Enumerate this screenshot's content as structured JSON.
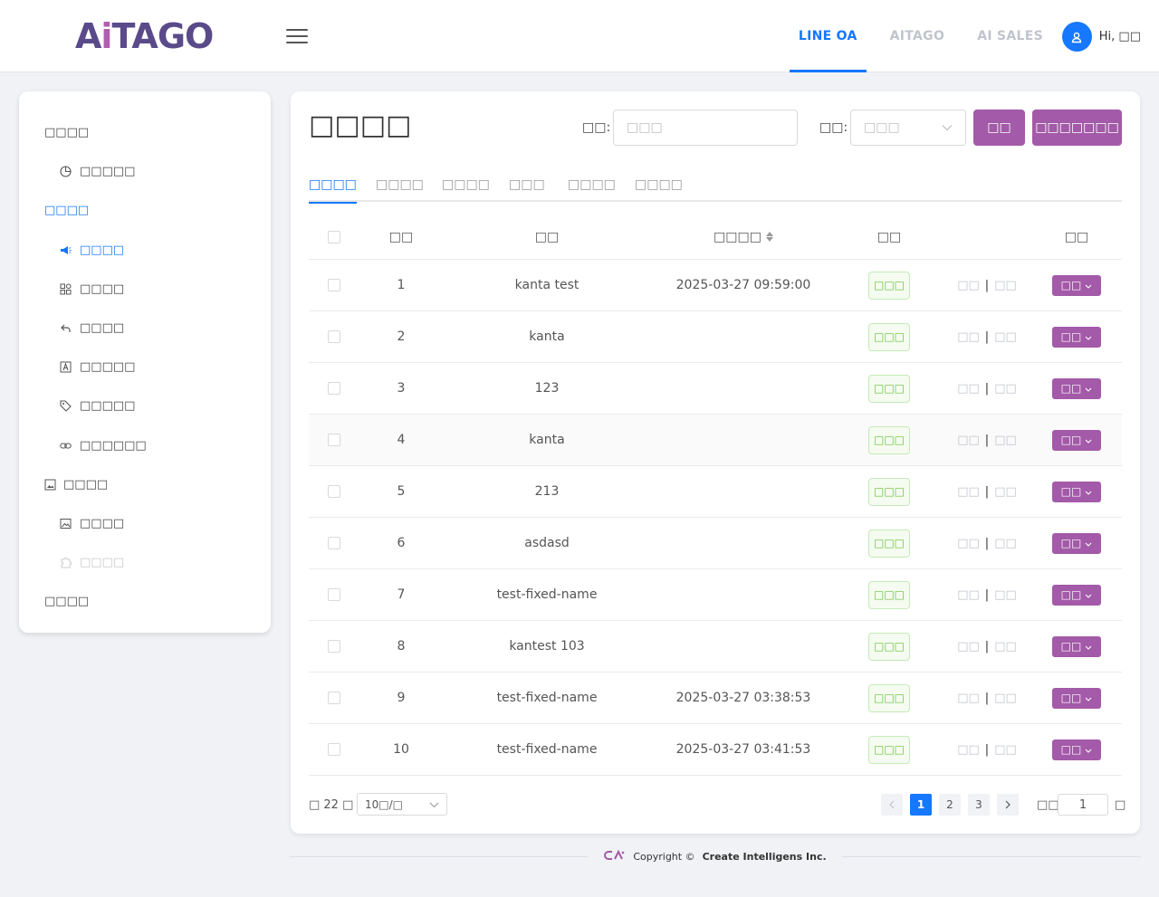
{
  "header": {
    "logo_text_a": "A",
    "logo_text_i": "i",
    "logo_text_rest": "TAGO",
    "nav": [
      "LINE OA",
      "AITAGO",
      "AI SALES"
    ],
    "active_nav": "LINE OA",
    "greeting": "Hi, □□"
  },
  "sidebar": {
    "groups": {
      "g1": "□□□□",
      "g2": "□□□□",
      "g3": "□□□□",
      "g4": "□□□□"
    },
    "items": {
      "dashboard": "□□□□□",
      "broadcast": "□□□□",
      "modules": "□□□□",
      "reply": "□□□□",
      "richmenu": "□□□□□",
      "tags": "□□□□□",
      "links": "□□□□□□",
      "images": "□□□□",
      "disabled_item": "□□□□"
    }
  },
  "main": {
    "title": "□□□□",
    "filter_name_label": "□□:",
    "filter_name_placeholder": "□□□",
    "filter_status_label": "□□:",
    "filter_status_placeholder": "□□□",
    "search_button": "□□",
    "create_button": "□□□□□□□",
    "tabs": [
      "□□□□",
      "□□□□",
      "□□□□",
      "□□□",
      "□□□□",
      "□□□□"
    ],
    "columns": {
      "index": "□□",
      "name": "□□",
      "send_time": "□□□□",
      "status": "□□",
      "op": "□□"
    },
    "rows": [
      {
        "idx": "1",
        "name": "kanta test",
        "date": "2025-03-27 09:59:00",
        "status": "□□□",
        "a1": "□□",
        "a2": "□□",
        "op": "□□"
      },
      {
        "idx": "2",
        "name": "kanta",
        "date": "",
        "status": "□□□",
        "a1": "□□",
        "a2": "□□",
        "op": "□□"
      },
      {
        "idx": "3",
        "name": "123",
        "date": "",
        "status": "□□□",
        "a1": "□□",
        "a2": "□□",
        "op": "□□"
      },
      {
        "idx": "4",
        "name": "kanta",
        "date": "",
        "status": "□□□",
        "a1": "□□",
        "a2": "□□",
        "op": "□□"
      },
      {
        "idx": "5",
        "name": "213",
        "date": "",
        "status": "□□□",
        "a1": "□□",
        "a2": "□□",
        "op": "□□"
      },
      {
        "idx": "6",
        "name": "asdasd",
        "date": "",
        "status": "□□□",
        "a1": "□□",
        "a2": "□□",
        "op": "□□"
      },
      {
        "idx": "7",
        "name": "test-fixed-name",
        "date": "",
        "status": "□□□",
        "a1": "□□",
        "a2": "□□",
        "op": "□□"
      },
      {
        "idx": "8",
        "name": "kantest 103",
        "date": "",
        "status": "□□□",
        "a1": "□□",
        "a2": "□□",
        "op": "□□"
      },
      {
        "idx": "9",
        "name": "test-fixed-name",
        "date": "2025-03-27 03:38:53",
        "status": "□□□",
        "a1": "□□",
        "a2": "□□",
        "op": "□□"
      },
      {
        "idx": "10",
        "name": "test-fixed-name",
        "date": "2025-03-27 03:41:53",
        "status": "□□□",
        "a1": "□□",
        "a2": "□□",
        "op": "□□"
      }
    ],
    "act_separator": "|"
  },
  "pagination": {
    "total": "□ 22 □",
    "page_size": "10□/□",
    "pages": [
      "1",
      "2",
      "3"
    ],
    "current_page": "1",
    "goto_label": "□□",
    "goto_value": "1",
    "goto_suffix": "□"
  },
  "footer": {
    "copyright": "Copyright ©",
    "company": "Create Intelligens Inc."
  },
  "colors": {
    "primary": "#1677ff",
    "purple": "#a35aa8",
    "status_green": "#67c23a"
  }
}
